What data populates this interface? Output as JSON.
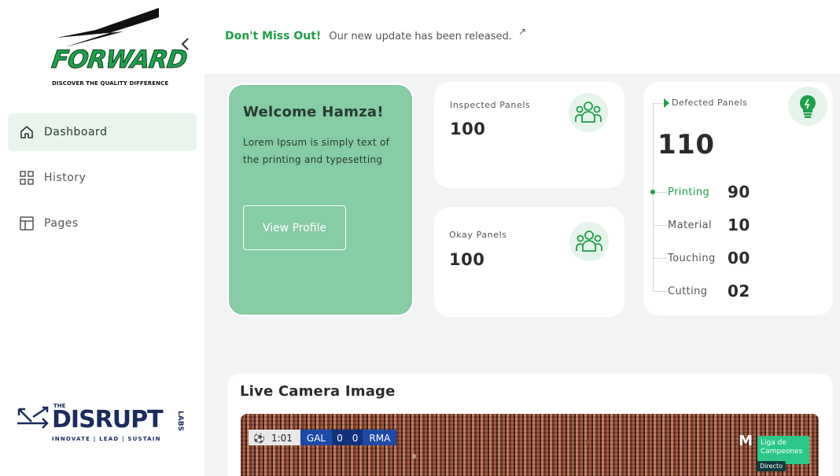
{
  "sidebar": {
    "logo": {
      "brand": "FORWARD",
      "tagline": "DISCOVER THE QUALITY DIFFERENCE"
    },
    "nav": [
      {
        "label": "Dashboard",
        "icon": "home-icon",
        "active": true
      },
      {
        "label": "History",
        "icon": "grid-icon",
        "active": false
      },
      {
        "label": "Pages",
        "icon": "layout-icon",
        "active": false
      }
    ],
    "footer_logo": {
      "the": "THE",
      "name": "DISRUPT",
      "labs": "LABS",
      "motto": "INNOVATE | LEAD | SUSTAIN"
    }
  },
  "topbar": {
    "highlight": "Don't Miss Out!",
    "message": "Our new update has been released.",
    "link_icon": "↗"
  },
  "welcome": {
    "title": "Welcome Hamza!",
    "text": "Lorem Ipsum is simply text of the printing and typesetting",
    "button": "View Profile"
  },
  "stats": {
    "inspected": {
      "label": "Inspected Panels",
      "value": "100",
      "icon": "users-icon"
    },
    "okay": {
      "label": "Okay Panels",
      "value": "100",
      "icon": "users-icon"
    }
  },
  "defected": {
    "label": "Defected Panels",
    "value": "110",
    "icon": "lightbulb-icon",
    "items": [
      {
        "name": "Printing",
        "value": "90",
        "active": true
      },
      {
        "name": "Material",
        "value": "10",
        "active": false
      },
      {
        "name": "Touching",
        "value": "00",
        "active": false
      },
      {
        "name": "Cutting",
        "value": "02",
        "active": false
      }
    ]
  },
  "live_camera": {
    "title": "Live Camera Image",
    "overlay": {
      "clock": "1:01",
      "home": "GAL",
      "home_score": "0",
      "away_score": "0",
      "away": "RMA",
      "league": "Liga de Campeones",
      "status": "Directo"
    }
  },
  "colors": {
    "accent": "#1fa04a",
    "welcome_bg": "#86cca5",
    "active_nav_bg": "#e8f4ec",
    "page_bg": "#f2f3f5"
  }
}
